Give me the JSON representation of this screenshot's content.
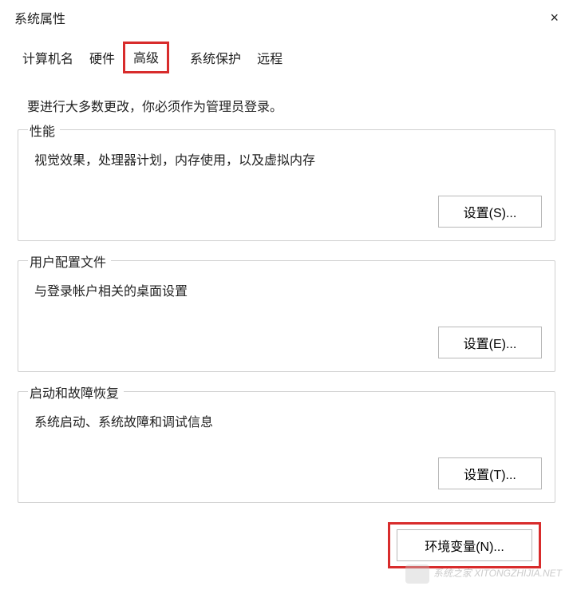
{
  "window": {
    "title": "系统属性",
    "close_label": "×"
  },
  "tabs": {
    "computer_name": "计算机名",
    "hardware": "硬件",
    "advanced": "高级",
    "system_protection": "系统保护",
    "remote": "远程"
  },
  "intro": "要进行大多数更改，你必须作为管理员登录。",
  "groups": {
    "performance": {
      "label": "性能",
      "desc": "视觉效果，处理器计划，内存使用，以及虚拟内存",
      "button": "设置(S)..."
    },
    "user_profiles": {
      "label": "用户配置文件",
      "desc": "与登录帐户相关的桌面设置",
      "button": "设置(E)..."
    },
    "startup_recovery": {
      "label": "启动和故障恢复",
      "desc": "系统启动、系统故障和调试信息",
      "button": "设置(T)..."
    }
  },
  "env_button": "环境变量(N)...",
  "watermark": "系统之家\nXITONGZHIJIA.NET"
}
